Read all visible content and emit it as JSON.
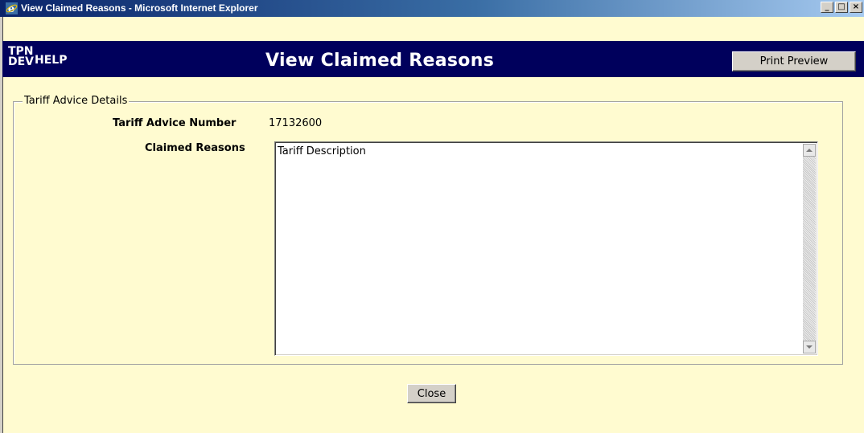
{
  "window": {
    "title": "View Claimed Reasons - Microsoft Internet Explorer",
    "icon": "internet-explorer-icon",
    "controls": {
      "minimize": "_",
      "maximize": "□",
      "close": "×"
    }
  },
  "header": {
    "brand_line1": "TPN",
    "brand_line2": "DEV",
    "help_label": "HELP",
    "page_title": "View Claimed Reasons",
    "print_preview_label": "Print Preview",
    "band_color": "#00005c"
  },
  "details": {
    "legend": "Tariff Advice Details",
    "tariff_advice_number_label": "Tariff Advice Number",
    "tariff_advice_number_value": "17132600",
    "claimed_reasons_label": "Claimed Reasons",
    "claimed_reasons_value": "Tariff Description"
  },
  "footer": {
    "close_label": "Close"
  },
  "colors": {
    "page_background": "#fffbd0",
    "title_bar": "#0a246a"
  }
}
